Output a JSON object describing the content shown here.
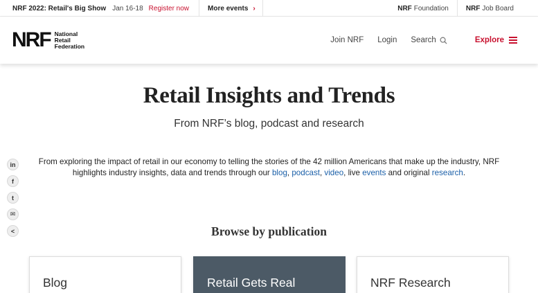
{
  "topbar": {
    "event_name": "NRF 2022: Retail's Big Show",
    "event_date": "Jan 16-18",
    "register": "Register now",
    "more_events": "More events",
    "foundation_bold": "NRF",
    "foundation_text": "Foundation",
    "jobboard_bold": "NRF",
    "jobboard_text": "Job Board"
  },
  "header": {
    "logo_mark": "NRF",
    "logo_line1": "National",
    "logo_line2": "Retail",
    "logo_line3": "Federation",
    "join": "Join NRF",
    "login": "Login",
    "search": "Search",
    "explore": "Explore"
  },
  "hero": {
    "title": "Retail Insights and Trends",
    "subtitle": "From NRF’s blog, podcast and research",
    "intro_part1": "From exploring the impact of retail in our economy to telling the stories of the 42 million Americans that make up the industry, NRF highlights industry insights, data and trends through our ",
    "link_blog": "blog",
    "sep1": ", ",
    "link_podcast": "podcast",
    "sep2": ", ",
    "link_video": "video",
    "sep3": ", live ",
    "link_events": "events",
    "sep4": " and original ",
    "link_research": "research",
    "end": "."
  },
  "share": {
    "linkedin": "in",
    "facebook": "f",
    "twitter": "t",
    "email": "✉",
    "more": "<"
  },
  "browse": {
    "heading": "Browse by publication",
    "cards": [
      {
        "label": "Blog"
      },
      {
        "label": "Retail Gets Real"
      },
      {
        "label": "NRF Research"
      }
    ]
  },
  "colors": {
    "accent": "#c8102e",
    "link": "#1a5fa8",
    "card_dark": "#4c5a66"
  }
}
